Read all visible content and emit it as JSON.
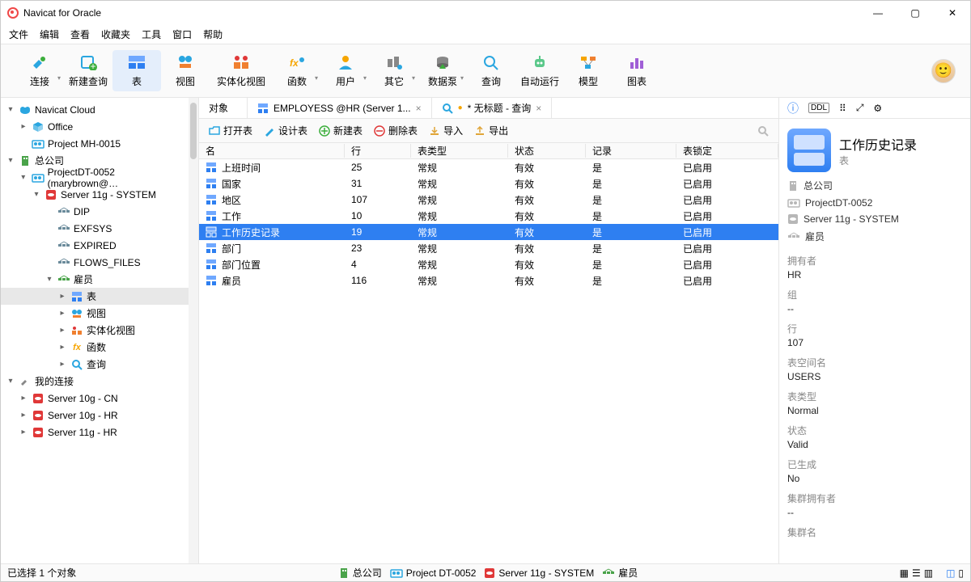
{
  "app": {
    "title": "Navicat for Oracle"
  },
  "menu": [
    "文件",
    "编辑",
    "查看",
    "收藏夹",
    "工具",
    "窗口",
    "帮助"
  ],
  "toolbar": [
    {
      "label": "连接",
      "icon": "plug",
      "dd": true
    },
    {
      "label": "新建查询",
      "icon": "newq"
    },
    {
      "label": "表",
      "icon": "table",
      "active": true
    },
    {
      "label": "视图",
      "icon": "view"
    },
    {
      "label": "实体化视图",
      "icon": "mview",
      "wide": true
    },
    {
      "label": "函数",
      "icon": "fx",
      "dd": true
    },
    {
      "label": "用户",
      "icon": "user",
      "dd": true
    },
    {
      "label": "其它",
      "icon": "other",
      "dd": true
    },
    {
      "label": "数据泵",
      "icon": "pump",
      "dd": true
    },
    {
      "label": "查询",
      "icon": "query"
    },
    {
      "label": "自动运行",
      "icon": "robot"
    },
    {
      "label": "模型",
      "icon": "model"
    },
    {
      "label": "图表",
      "icon": "chart"
    }
  ],
  "tree": [
    {
      "d": 0,
      "caret": "▾",
      "icon": "cloud",
      "color": "#2aa6e0",
      "label": "Navicat Cloud"
    },
    {
      "d": 1,
      "caret": "▸",
      "icon": "box",
      "color": "#2aa6e0",
      "label": "Office"
    },
    {
      "d": 1,
      "caret": "",
      "icon": "proj",
      "color": "#2aa6e0",
      "label": "Project MH-0015"
    },
    {
      "d": 0,
      "caret": "▾",
      "icon": "org",
      "color": "#4aa34a",
      "label": "总公司"
    },
    {
      "d": 1,
      "caret": "▾",
      "icon": "proj",
      "color": "#2aa6e0",
      "label": "ProjectDT-0052 (marybrown@…"
    },
    {
      "d": 2,
      "caret": "▾",
      "icon": "srv",
      "color": "#e03838",
      "label": "Server 11g - SYSTEM"
    },
    {
      "d": 3,
      "caret": "",
      "icon": "schema",
      "color": "#6b8b9b",
      "label": "DIP"
    },
    {
      "d": 3,
      "caret": "",
      "icon": "schema",
      "color": "#6b8b9b",
      "label": "EXFSYS"
    },
    {
      "d": 3,
      "caret": "",
      "icon": "schema",
      "color": "#6b8b9b",
      "label": "EXPIRED"
    },
    {
      "d": 3,
      "caret": "",
      "icon": "schema",
      "color": "#6b8b9b",
      "label": "FLOWS_FILES"
    },
    {
      "d": 3,
      "caret": "▾",
      "icon": "schema",
      "color": "#4aa34a",
      "label": "雇员"
    },
    {
      "d": 4,
      "caret": "▸",
      "icon": "tbl",
      "color": "#2e7ff1",
      "label": "表",
      "sel": true
    },
    {
      "d": 4,
      "caret": "▸",
      "icon": "vw",
      "color": "#2aa6e0",
      "label": "视图"
    },
    {
      "d": 4,
      "caret": "▸",
      "icon": "mvw",
      "color": "#f08030",
      "label": "实体化视图"
    },
    {
      "d": 4,
      "caret": "▸",
      "icon": "fx",
      "color": "#f6a500",
      "label": "函数"
    },
    {
      "d": 4,
      "caret": "▸",
      "icon": "qry",
      "color": "#2aa6e0",
      "label": "查询"
    },
    {
      "d": 0,
      "caret": "▾",
      "icon": "plug",
      "color": "#888",
      "label": "我的连接"
    },
    {
      "d": 1,
      "caret": "▸",
      "icon": "srv",
      "color": "#e03838",
      "label": "Server 10g - CN"
    },
    {
      "d": 1,
      "caret": "▸",
      "icon": "srv",
      "color": "#e03838",
      "label": "Server 10g - HR"
    },
    {
      "d": 1,
      "caret": "▸",
      "icon": "srv",
      "color": "#e03838",
      "label": "Server 11g - HR"
    }
  ],
  "tabs": [
    {
      "label": "对象",
      "icon": ""
    },
    {
      "label": "EMPLOYESS @HR (Server 1...",
      "icon": "tbl",
      "close": true
    },
    {
      "label": "* 无标题 - 查询",
      "icon": "qry",
      "close": true,
      "dirty": true
    }
  ],
  "subtool": [
    {
      "label": "打开表",
      "icon": "open",
      "color": "#2aa6e0"
    },
    {
      "label": "设计表",
      "icon": "design",
      "color": "#2aa6e0"
    },
    {
      "label": "新建表",
      "icon": "new",
      "color": "#3cae3c"
    },
    {
      "label": "删除表",
      "icon": "del",
      "color": "#e03838"
    },
    {
      "label": "导入",
      "icon": "imp",
      "color": "#e0a538"
    },
    {
      "label": "导出",
      "icon": "exp",
      "color": "#e0a538"
    }
  ],
  "columns": [
    "名",
    "行",
    "表类型",
    "状态",
    "记录",
    "表锁定"
  ],
  "rows": [
    {
      "name": "上班时间",
      "rows": "25",
      "type": "常规",
      "status": "有效",
      "rec": "是",
      "lock": "已启用"
    },
    {
      "name": "国家",
      "rows": "31",
      "type": "常规",
      "status": "有效",
      "rec": "是",
      "lock": "已启用"
    },
    {
      "name": "地区",
      "rows": "107",
      "type": "常规",
      "status": "有效",
      "rec": "是",
      "lock": "已启用"
    },
    {
      "name": "工作",
      "rows": "10",
      "type": "常规",
      "status": "有效",
      "rec": "是",
      "lock": "已启用"
    },
    {
      "name": "工作历史记录",
      "rows": "19",
      "type": "常规",
      "status": "有效",
      "rec": "是",
      "lock": "已启用",
      "sel": true
    },
    {
      "name": "部门",
      "rows": "23",
      "type": "常规",
      "status": "有效",
      "rec": "是",
      "lock": "已启用"
    },
    {
      "name": "部门位置",
      "rows": "4",
      "type": "常规",
      "status": "有效",
      "rec": "是",
      "lock": "已启用"
    },
    {
      "name": "雇员",
      "rows": "116",
      "type": "常规",
      "status": "有效",
      "rec": "是",
      "lock": "已启用"
    }
  ],
  "detail": {
    "title": "工作历史记录",
    "sub": "表",
    "crumbs": [
      "总公司",
      "ProjectDT-0052",
      "Server 11g - SYSTEM",
      "雇员"
    ],
    "props": [
      {
        "l": "拥有者",
        "v": "HR"
      },
      {
        "l": "组",
        "v": "--"
      },
      {
        "l": "行",
        "v": "107"
      },
      {
        "l": "表空间名",
        "v": "USERS"
      },
      {
        "l": "表类型",
        "v": "Normal"
      },
      {
        "l": "状态",
        "v": "Valid"
      },
      {
        "l": "已生成",
        "v": "No"
      },
      {
        "l": "集群拥有者",
        "v": "--"
      },
      {
        "l": "集群名",
        "v": ""
      }
    ]
  },
  "status": {
    "left": "已选择 1 个对象",
    "path": [
      {
        "icon": "org",
        "color": "#4aa34a",
        "label": "总公司"
      },
      {
        "icon": "proj",
        "color": "#2aa6e0",
        "label": "Project DT-0052"
      },
      {
        "icon": "srv",
        "color": "#e03838",
        "label": "Server 11g - SYSTEM"
      },
      {
        "icon": "schema",
        "color": "#4aa34a",
        "label": "雇员"
      }
    ]
  }
}
